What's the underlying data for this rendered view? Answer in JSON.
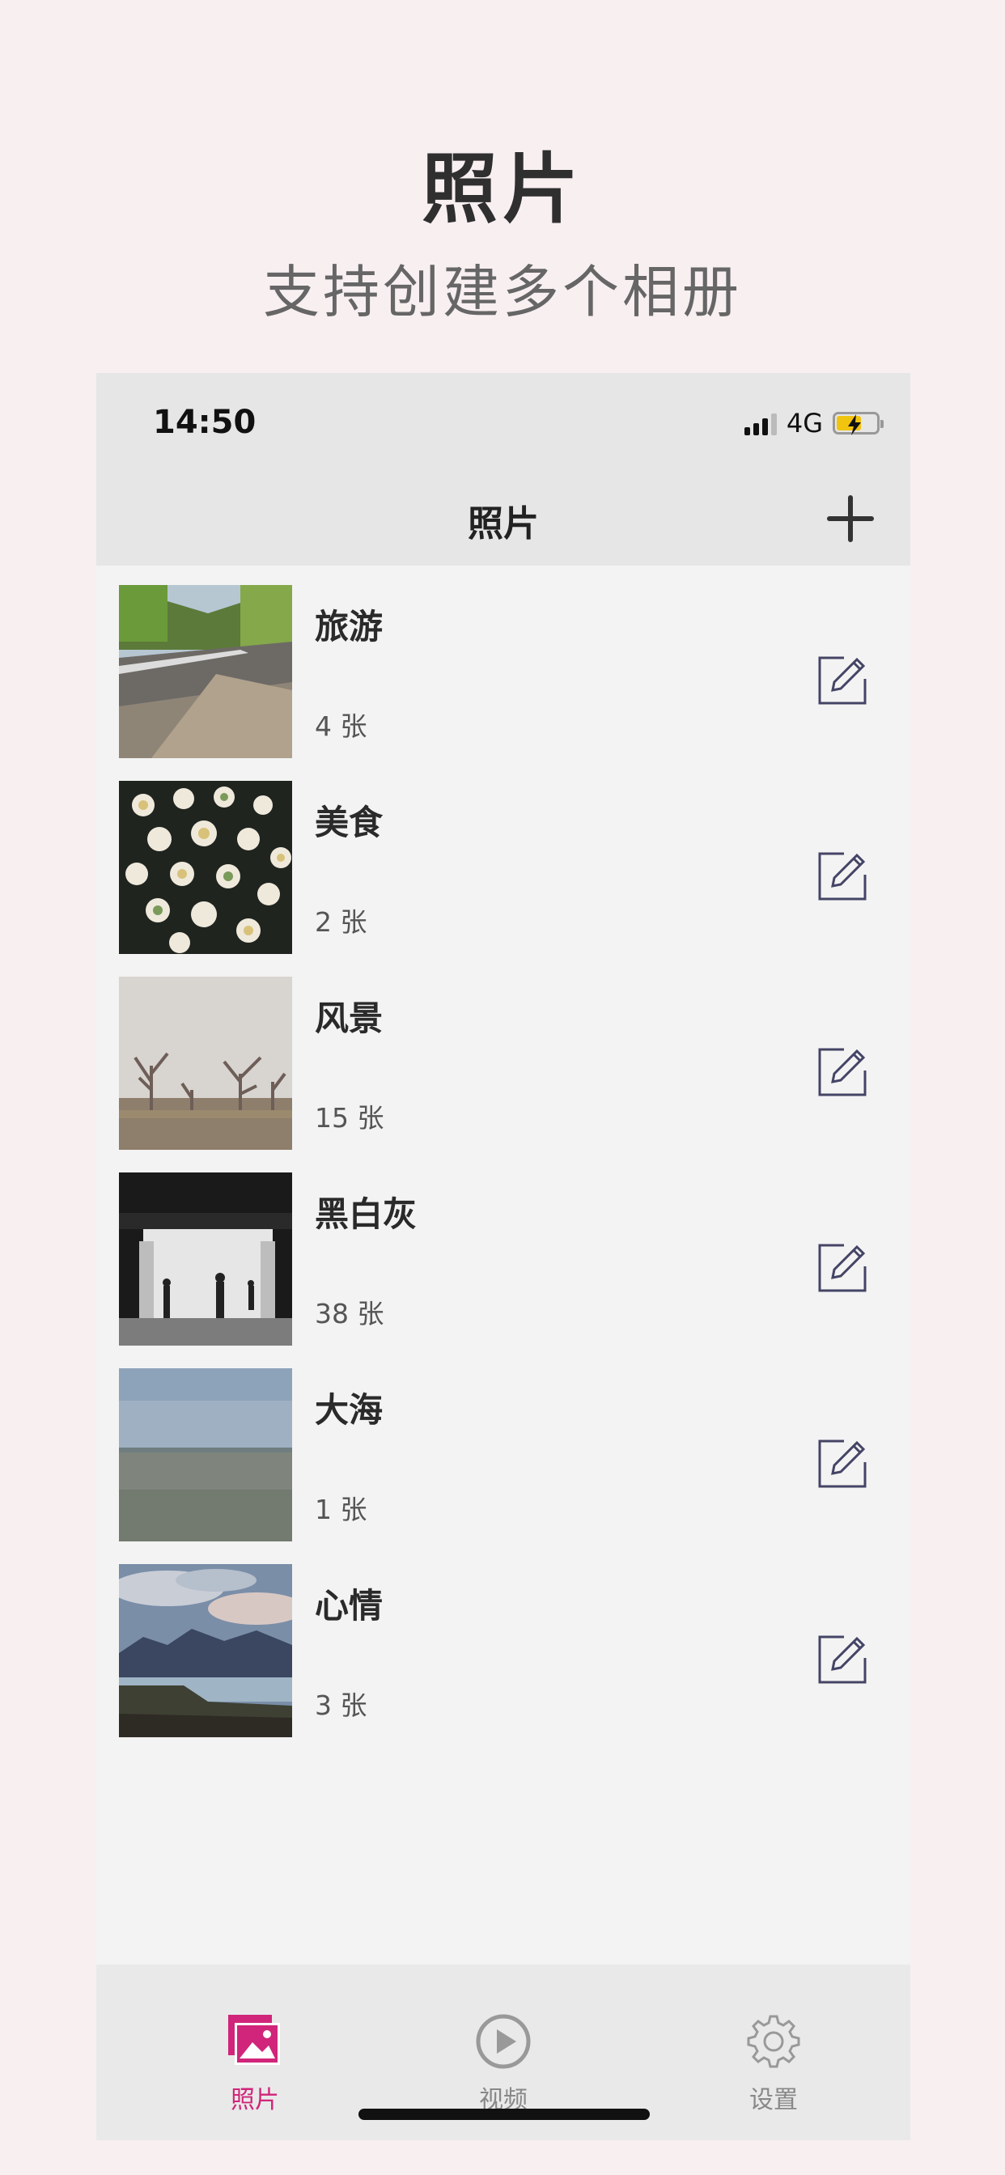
{
  "promo": {
    "title": "照片",
    "subtitle": "支持创建多个相册"
  },
  "status_bar": {
    "time": "14:50",
    "network": "4G",
    "battery_icon": "battery-charging-icon"
  },
  "nav": {
    "title": "照片",
    "add_icon": "plus-icon"
  },
  "albums": [
    {
      "name": "旅游",
      "count": "4 张"
    },
    {
      "name": "美食",
      "count": "2 张"
    },
    {
      "name": "风景",
      "count": "15 张"
    },
    {
      "name": "黑白灰",
      "count": "38 张"
    },
    {
      "name": "大海",
      "count": "1 张"
    },
    {
      "name": "心情",
      "count": "3 张"
    }
  ],
  "tabs": [
    {
      "label": "照片",
      "icon": "photo-icon",
      "active": true
    },
    {
      "label": "视频",
      "icon": "play-icon",
      "active": false
    },
    {
      "label": "设置",
      "icon": "gear-icon",
      "active": false
    }
  ],
  "colors": {
    "accent": "#d0257a",
    "inactive": "#999999",
    "background": "#f8eff0"
  }
}
